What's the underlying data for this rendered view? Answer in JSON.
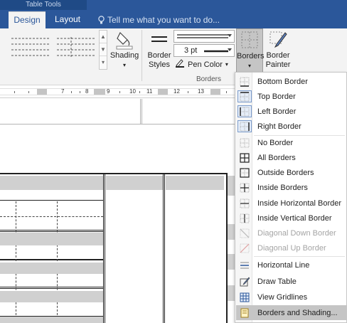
{
  "window": {
    "context_label": "Table Tools",
    "tabs": [
      {
        "label": "Design",
        "active": true
      },
      {
        "label": "Layout",
        "active": false
      }
    ],
    "tell_me": "Tell me what you want to do..."
  },
  "ribbon": {
    "shading_label": "Shading",
    "border_styles_label_1": "Border",
    "border_styles_label_2": "Styles",
    "line_weight_value": "3 pt",
    "pen_color_label": "Pen Color",
    "borders_button_label": "Borders",
    "border_painter_label_1": "Border",
    "border_painter_label_2": "Painter",
    "group_label": "Borders",
    "pen_color_hex": "#222222"
  },
  "ruler": {
    "numbers": [
      "7",
      "8",
      "9",
      "10",
      "11",
      "12",
      "13"
    ]
  },
  "borders_menu": {
    "items": [
      {
        "label": "Bottom Border",
        "icon": "bottom-border-icon",
        "disabled": false
      },
      {
        "label": "Top Border",
        "icon": "top-border-icon",
        "disabled": false
      },
      {
        "label": "Left Border",
        "icon": "left-border-icon",
        "disabled": false
      },
      {
        "label": "Right Border",
        "icon": "right-border-icon",
        "disabled": false
      },
      {
        "label": "No Border",
        "icon": "no-border-icon",
        "disabled": false
      },
      {
        "label": "All Borders",
        "icon": "all-borders-icon",
        "disabled": false
      },
      {
        "label": "Outside Borders",
        "icon": "outside-borders-icon",
        "disabled": false
      },
      {
        "label": "Inside Borders",
        "icon": "inside-borders-icon",
        "disabled": false
      },
      {
        "label": "Inside Horizontal Border",
        "icon": "inside-horizontal-border-icon",
        "disabled": false
      },
      {
        "label": "Inside Vertical Border",
        "icon": "inside-vertical-border-icon",
        "disabled": false
      },
      {
        "label": "Diagonal Down Border",
        "icon": "diagonal-down-border-icon",
        "disabled": true
      },
      {
        "label": "Diagonal Up Border",
        "icon": "diagonal-up-border-icon",
        "disabled": true
      },
      {
        "label": "Horizontal Line",
        "icon": "horizontal-line-icon",
        "disabled": false
      },
      {
        "label": "Draw Table",
        "icon": "draw-table-icon",
        "disabled": false
      },
      {
        "label": "View Gridlines",
        "icon": "view-gridlines-icon",
        "disabled": false
      },
      {
        "label": "Borders and Shading...",
        "icon": "borders-and-shading-icon",
        "disabled": false,
        "highlighted": true
      }
    ]
  },
  "colors": {
    "title_bar": "#2b579a",
    "ribbon_bg": "#f3f3f3",
    "pressed_button": "#c5c5c5",
    "table_shade": "#d0d0d0"
  }
}
